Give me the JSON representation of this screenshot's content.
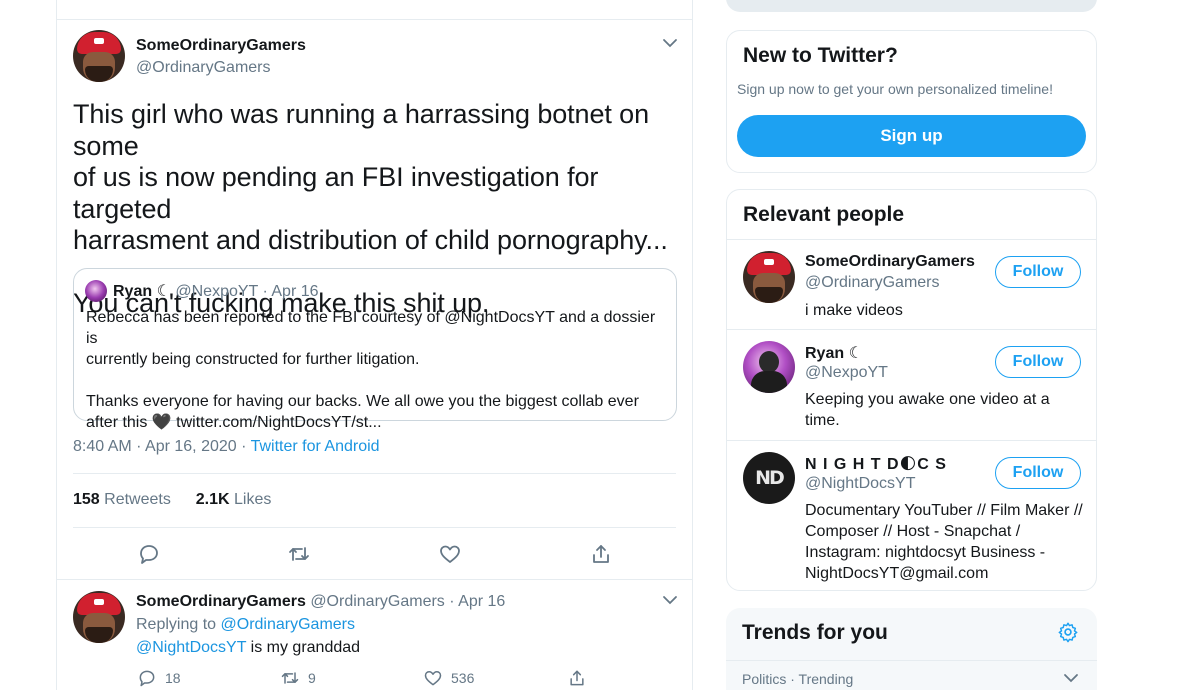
{
  "tweet": {
    "author_name": "SomeOrdinaryGamers",
    "author_handle": "@OrdinaryGamers",
    "lines": [
      "This girl who was running a harrassing botnet on some",
      "of us is now pending an FBI investigation for targeted",
      "harrasment and distribution of child pornography...",
      "",
      "You can't fucking make this shit up."
    ],
    "quote": {
      "name": "Ryan ☾",
      "handle": "@NexpoYT",
      "sep": "·",
      "date": "Apr 16",
      "line1": "Rebecca has been reported to the FBI courtesy of @NightDocsYT and a dossier is",
      "line2": "currently being constructed for further litigation.",
      "line3": "Thanks everyone for having our backs. We all owe you the biggest collab ever",
      "line4": "after this 🖤 twitter.com/NightDocsYT/st..."
    },
    "time": "8:40 AM · Apr 16, 2020 · ",
    "source": "Twitter for Android",
    "retweets_count": "158",
    "retweets_label": "Retweets",
    "likes_count": "2.1K",
    "likes_label": "Likes"
  },
  "reply": {
    "author_name": "SomeOrdinaryGamers",
    "author_handle": "@OrdinaryGamers",
    "sep": "·",
    "date": "Apr 16",
    "replying_label": "Replying to",
    "replying_to": "@OrdinaryGamers",
    "mention": "@NightDocsYT",
    "text": " is my granddad",
    "reply_count": "18",
    "retweet_count": "9",
    "like_count": "536"
  },
  "sidebar": {
    "signup": {
      "title": "New to Twitter?",
      "subtitle": "Sign up now to get your own personalized timeline!",
      "button": "Sign up"
    },
    "relevant": {
      "title": "Relevant people",
      "follow_label": "Follow",
      "people": [
        {
          "name": "SomeOrdinaryGamers",
          "handle": "@OrdinaryGamers",
          "bio": "i make videos"
        },
        {
          "name": "Ryan ☾",
          "handle": "@NexpoYT",
          "bio": "Keeping you awake one video at a time."
        },
        {
          "name": "N I G H T D🌓C S",
          "handle": "@NightDocsYT",
          "bio": "Documentary YouTuber // Film Maker // Composer // Host - Snapchat / Instagram: nightdocsyt Business - NightDocsYT@gmail.com"
        }
      ]
    },
    "trends": {
      "title": "Trends for you",
      "first_meta": "Politics · Trending"
    }
  },
  "colors": {
    "accent": "#1da1f2",
    "link": "#1b95e0",
    "secondary_text": "#657786",
    "divider": "#e6ecf0"
  },
  "icons": {
    "reply": "reply-icon",
    "retweet": "retweet-icon",
    "like": "heart-icon",
    "share": "share-icon",
    "more": "chevron-down-icon",
    "settings": "gear-icon"
  }
}
